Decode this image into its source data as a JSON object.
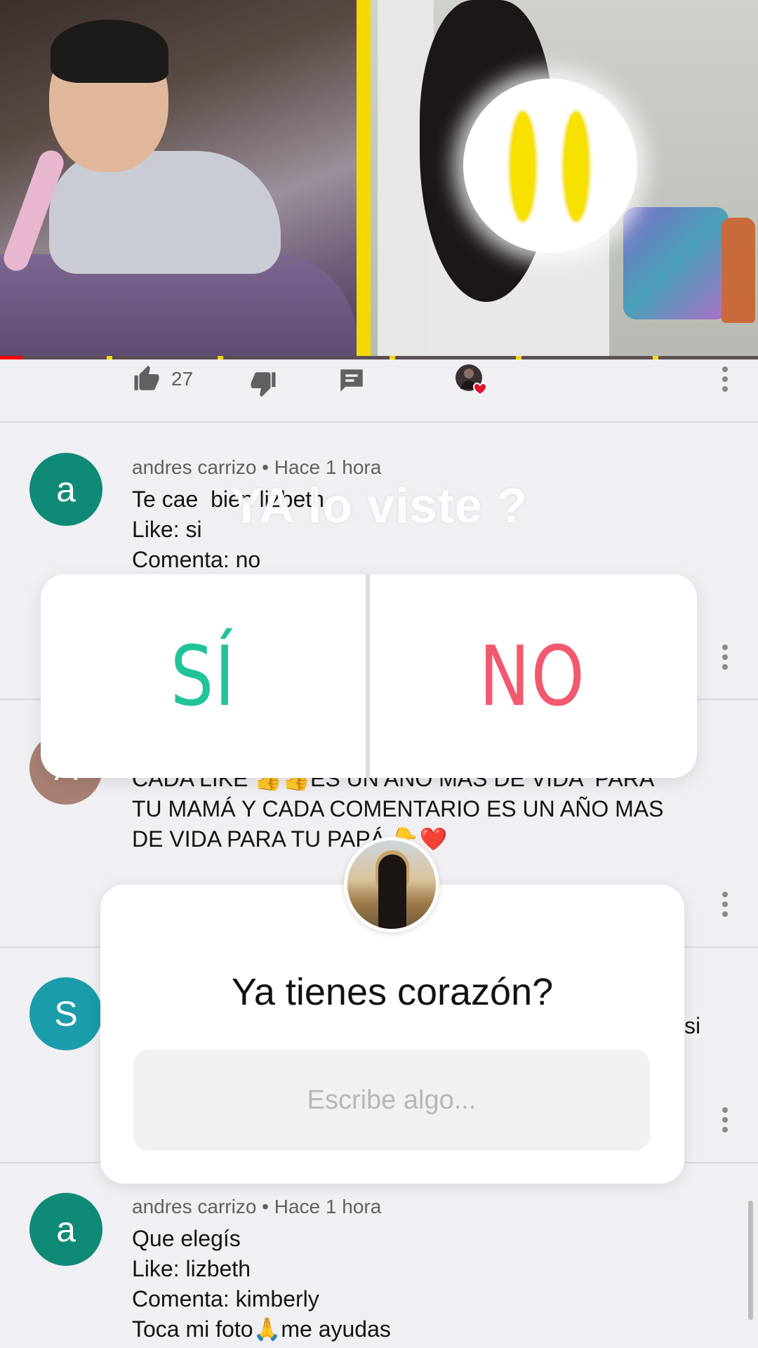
{
  "video": {
    "progress_fraction": 0.03
  },
  "actions": {
    "like_count": "27"
  },
  "story": {
    "title": "YA lo viste ?",
    "poll": {
      "yes": "SÍ",
      "no": "NO"
    },
    "question": {
      "title": "Ya tienes corazón?",
      "placeholder": "Escribe algo..."
    }
  },
  "comments": [
    {
      "avatar_letter": "a",
      "avatar_color": "#0f8a76",
      "meta": "andres carrizo • Hace 1 hora",
      "text": "Te cae  bien lizbeth\nLike: si\nComenta: no"
    },
    {
      "avatar_letter": "A",
      "avatar_color": "#a88073",
      "meta": "",
      "text": "CADA LIKE 👍👍ES UN AÑO MAS DE VIDA  PARA\nTU MAMÁ Y CADA COMENTARIO ES UN AÑO MAS\nDE VIDA PARA TU PAPÁ 👇❤️"
    },
    {
      "avatar_letter": "S",
      "avatar_color": "#1b9cab",
      "meta": "",
      "text": "si"
    },
    {
      "avatar_letter": "a",
      "avatar_color": "#0f8a76",
      "meta": "andres carrizo • Hace 1 hora",
      "text": "Que elegís\nLike: lizbeth\nComenta: kimberly\nToca mi foto🙏me ayudas"
    }
  ],
  "colors": {
    "poll_yes": "#22c39a",
    "poll_no": "#f3596e",
    "divider_yellow": "#f5d800",
    "progress_red": "#ff0000"
  },
  "icons": [
    "thumbs-up-icon",
    "thumbs-down-icon",
    "comment-icon",
    "channel-avatar-heart-icon",
    "more-vertical-icon"
  ]
}
